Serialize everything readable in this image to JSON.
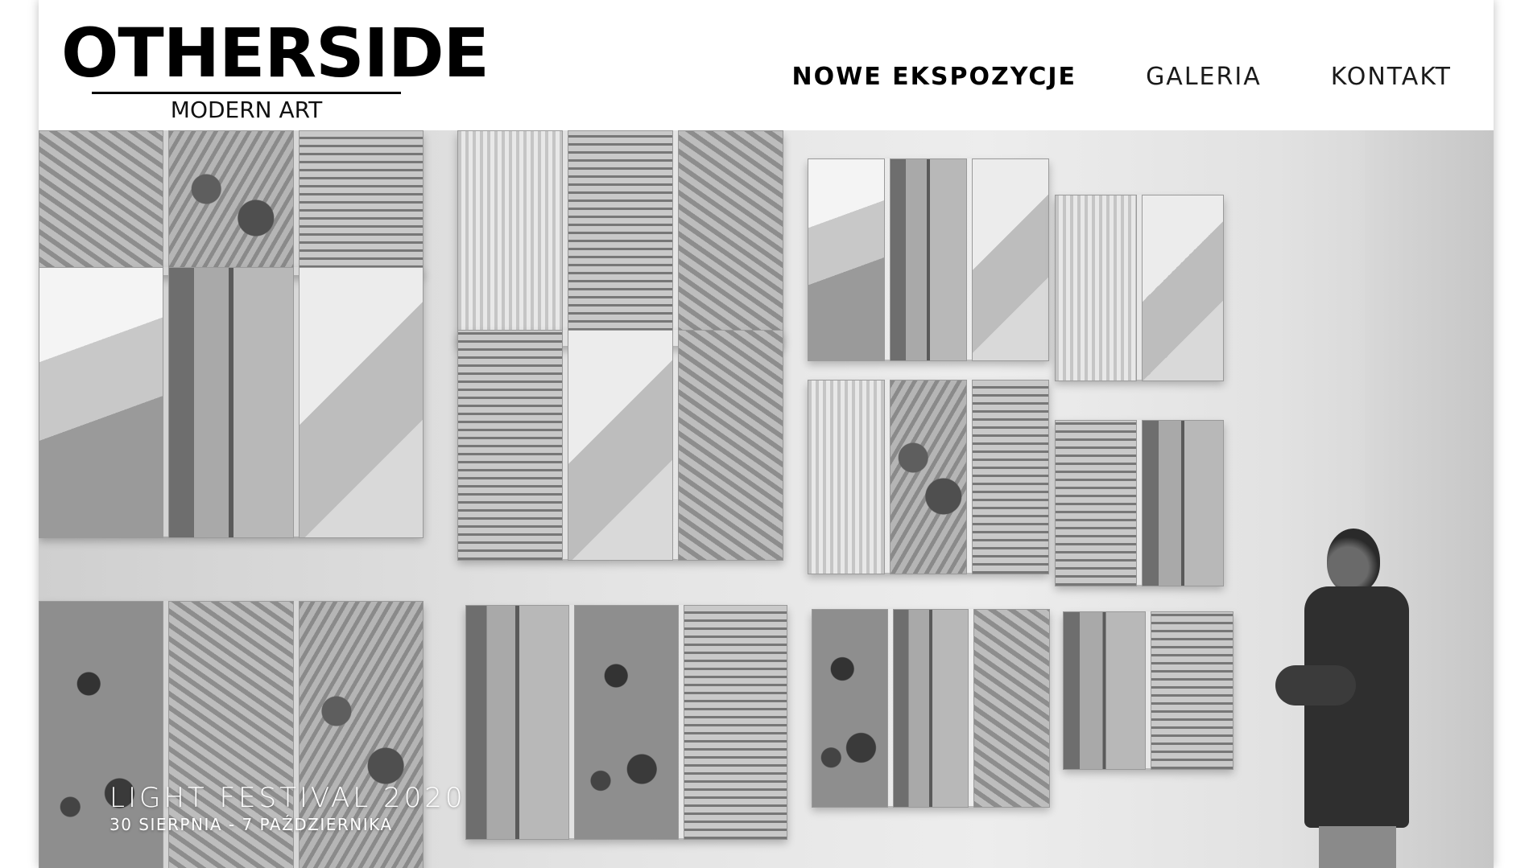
{
  "brand": {
    "title": "OTHERSIDE",
    "subtitle": "MODERN ART"
  },
  "nav": {
    "items": [
      {
        "label": "NOWE EKSPOZYCJE",
        "active": true
      },
      {
        "label": "GALERIA",
        "active": false
      },
      {
        "label": "KONTAKT",
        "active": false
      }
    ]
  },
  "hero": {
    "image": "gallery-wall-aerial-photos-with-visitor",
    "caption_title": "LIGHT FESTIVAL 2020",
    "caption_dates": "30 SIERPNIA - 7 PAŹDZIERNIKA"
  },
  "colors": {
    "header_bg": "#ffffff",
    "text_dark": "#000000",
    "caption_text": "#ffffff"
  }
}
